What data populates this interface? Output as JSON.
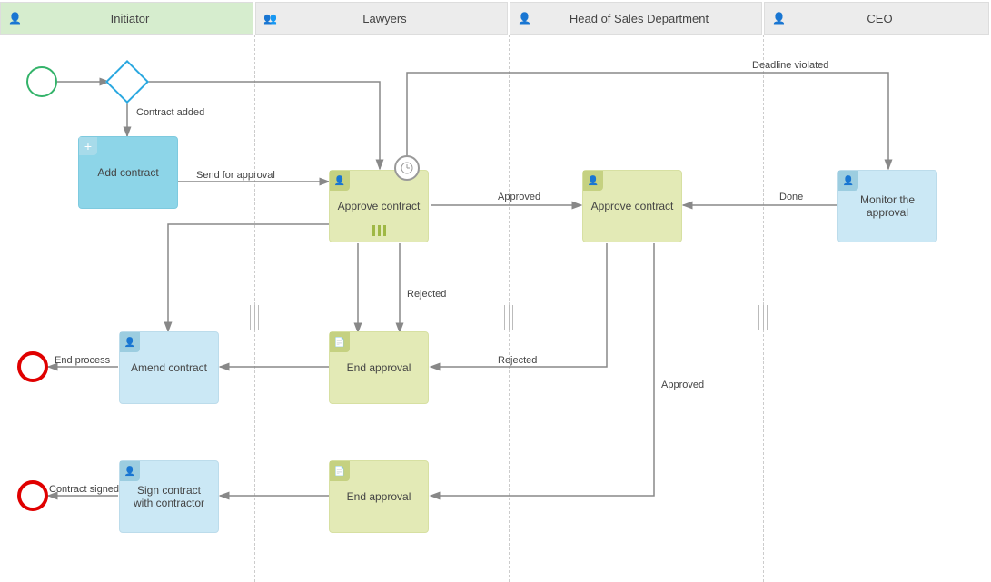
{
  "lanes": {
    "initiator": "Initiator",
    "lawyers": "Lawyers",
    "head": "Head of Sales Department",
    "ceo": "CEO"
  },
  "tasks": {
    "add_contract": "Add contract",
    "approve_contract_lawyers": "Approve contract",
    "approve_contract_head": "Approve contract",
    "monitor": "Monitor the approval",
    "amend": "Amend contract",
    "end_approval_1": "End approval",
    "end_approval_2": "End approval",
    "sign": "Sign contract with contractor"
  },
  "edges": {
    "contract_added": "Contract added",
    "send_for_approval": "Send for approval",
    "deadline_violated": "Deadline violated",
    "approved_1": "Approved",
    "done": "Done",
    "rejected_1": "Rejected",
    "rejected_2": "Rejected",
    "approved_2": "Approved",
    "end_process": "End process",
    "contract_signed": "Contract signed"
  },
  "chart_data": {
    "type": "bpmn-diagram",
    "lanes": [
      {
        "id": "initiator",
        "label": "Initiator",
        "actor": "single"
      },
      {
        "id": "lawyers",
        "label": "Lawyers",
        "actor": "group"
      },
      {
        "id": "head",
        "label": "Head of Sales Department",
        "actor": "single"
      },
      {
        "id": "ceo",
        "label": "CEO",
        "actor": "single"
      }
    ],
    "nodes": [
      {
        "id": "start",
        "type": "start-event",
        "lane": "initiator"
      },
      {
        "id": "gw1",
        "type": "exclusive-gateway",
        "lane": "initiator"
      },
      {
        "id": "add_contract",
        "type": "task",
        "lane": "initiator",
        "label": "Add contract",
        "marker": "expand"
      },
      {
        "id": "approve_lawyers",
        "type": "user-task",
        "lane": "lawyers",
        "label": "Approve contract",
        "multi_instance": "parallel",
        "boundary": "timer"
      },
      {
        "id": "approve_head",
        "type": "user-task",
        "lane": "head",
        "label": "Approve contract"
      },
      {
        "id": "monitor",
        "type": "user-task",
        "lane": "ceo",
        "label": "Monitor the approval"
      },
      {
        "id": "amend",
        "type": "user-task",
        "lane": "initiator",
        "label": "Amend contract"
      },
      {
        "id": "end_approval_1",
        "type": "script-task",
        "lane": "lawyers",
        "label": "End approval"
      },
      {
        "id": "end_approval_2",
        "type": "script-task",
        "lane": "lawyers",
        "label": "End approval"
      },
      {
        "id": "sign",
        "type": "user-task",
        "lane": "initiator",
        "label": "Sign contract with contractor"
      },
      {
        "id": "end1",
        "type": "end-event",
        "lane": "initiator"
      },
      {
        "id": "end2",
        "type": "end-event",
        "lane": "initiator"
      }
    ],
    "flows": [
      {
        "from": "start",
        "to": "gw1"
      },
      {
        "from": "gw1",
        "to": "add_contract",
        "label": "Contract added"
      },
      {
        "from": "gw1",
        "to": "approve_lawyers"
      },
      {
        "from": "add_contract",
        "to": "approve_lawyers",
        "label": "Send for approval"
      },
      {
        "from": "approve_lawyers",
        "to": "approve_head",
        "label": "Approved"
      },
      {
        "from": "approve_lawyers",
        "to": "end_approval_1",
        "label": "Rejected"
      },
      {
        "from": "approve_lawyers",
        "to": "monitor",
        "label": "Deadline violated",
        "boundary": true
      },
      {
        "from": "approve_lawyers",
        "to": "amend"
      },
      {
        "from": "monitor",
        "to": "approve_head",
        "label": "Done"
      },
      {
        "from": "approve_head",
        "to": "end_approval_1",
        "label": "Rejected"
      },
      {
        "from": "approve_head",
        "to": "end_approval_2",
        "label": "Approved"
      },
      {
        "from": "end_approval_1",
        "to": "amend"
      },
      {
        "from": "amend",
        "to": "end1",
        "label": "End process"
      },
      {
        "from": "amend",
        "to": "gw1"
      },
      {
        "from": "end_approval_2",
        "to": "sign"
      },
      {
        "from": "sign",
        "to": "end2",
        "label": "Contract signed"
      }
    ]
  }
}
